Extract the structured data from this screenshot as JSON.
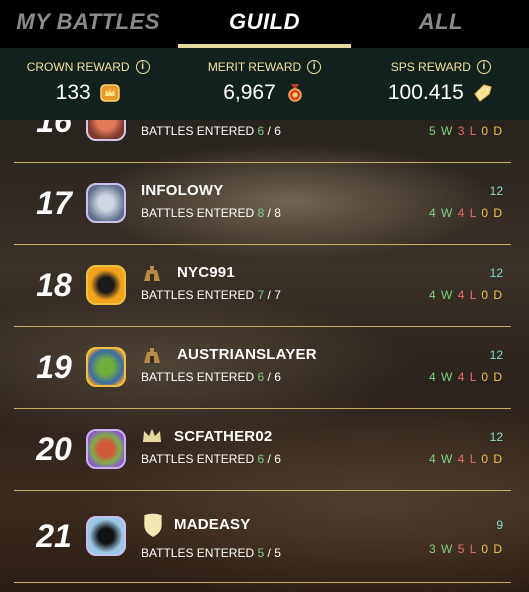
{
  "tabs": [
    {
      "label": "MY BATTLES",
      "active": false
    },
    {
      "label": "GUILD",
      "active": true
    },
    {
      "label": "ALL",
      "active": false
    }
  ],
  "rewards": [
    {
      "label": "CROWN REWARD",
      "value": "133",
      "icon": "crown-coin-icon"
    },
    {
      "label": "MERIT REWARD",
      "value": "6,967",
      "icon": "merit-medal-icon"
    },
    {
      "label": "SPS REWARD",
      "value": "100.415",
      "icon": "sps-token-icon"
    }
  ],
  "entered_label": "BATTLES ENTERED",
  "rows": [
    {
      "rank": "16",
      "name": "",
      "entered": "6",
      "total": "6",
      "points": "",
      "w": "5",
      "l": "3",
      "d": "0",
      "badge": ""
    },
    {
      "rank": "17",
      "name": "INFOLOWY",
      "entered": "8",
      "total": "8",
      "points": "12",
      "w": "4",
      "l": "4",
      "d": "0",
      "badge": ""
    },
    {
      "rank": "18",
      "name": "NYC991",
      "entered": "7",
      "total": "7",
      "points": "12",
      "w": "4",
      "l": "4",
      "d": "0",
      "badge": "tower-icon"
    },
    {
      "rank": "19",
      "name": "AUSTRIANSLAYER",
      "entered": "6",
      "total": "6",
      "points": "12",
      "w": "4",
      "l": "4",
      "d": "0",
      "badge": "tower-icon"
    },
    {
      "rank": "20",
      "name": "SCFATHER02",
      "entered": "6",
      "total": "6",
      "points": "12",
      "w": "4",
      "l": "4",
      "d": "0",
      "badge": "crown-icon"
    },
    {
      "rank": "21",
      "name": "MADEASY",
      "entered": "5",
      "total": "5",
      "points": "9",
      "w": "3",
      "l": "5",
      "d": "0",
      "badge": "shield-icon"
    }
  ],
  "colors": {
    "accent": "#f2e39c",
    "win": "#7fd37b",
    "loss": "#ec6a6a",
    "draw": "#f0c24a",
    "points": "#87d8d0"
  }
}
